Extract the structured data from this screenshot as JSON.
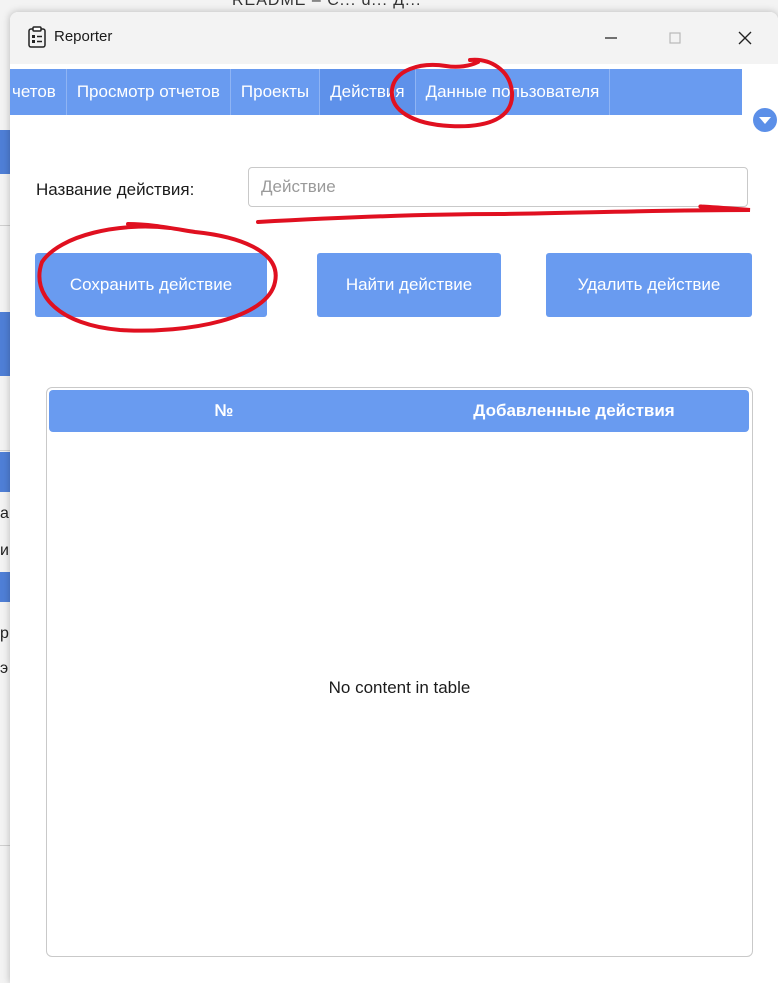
{
  "background_window": {
    "title_fragment": "README – C... d... Д...",
    "edge_chars": [
      "а",
      "и",
      "р",
      "э"
    ]
  },
  "window": {
    "title": "Reporter",
    "app_icon": "clipboard-icon",
    "controls": {
      "minimize_icon": "minimize-icon",
      "maximize_icon": "maximize-icon",
      "close_icon": "close-icon"
    }
  },
  "tabs": [
    {
      "label": "четов",
      "active": false
    },
    {
      "label": "Просмотр отчетов",
      "active": false
    },
    {
      "label": "Проекты",
      "active": false
    },
    {
      "label": "Действия",
      "active": true
    },
    {
      "label": "Данные пользователя",
      "active": false
    }
  ],
  "tab_overflow_icon": "chevron-down-circle-icon",
  "form": {
    "label": "Название действия:",
    "input_value": "",
    "input_placeholder": "Действие"
  },
  "buttons": {
    "save": "Сохранить действие",
    "find": "Найти действие",
    "delete": "Удалить действие"
  },
  "table": {
    "columns": [
      "№",
      "Добавленные действия"
    ],
    "rows": [],
    "empty_message": "No content in table"
  },
  "colors": {
    "accent": "#699bf0",
    "annotation": "#e01020"
  }
}
